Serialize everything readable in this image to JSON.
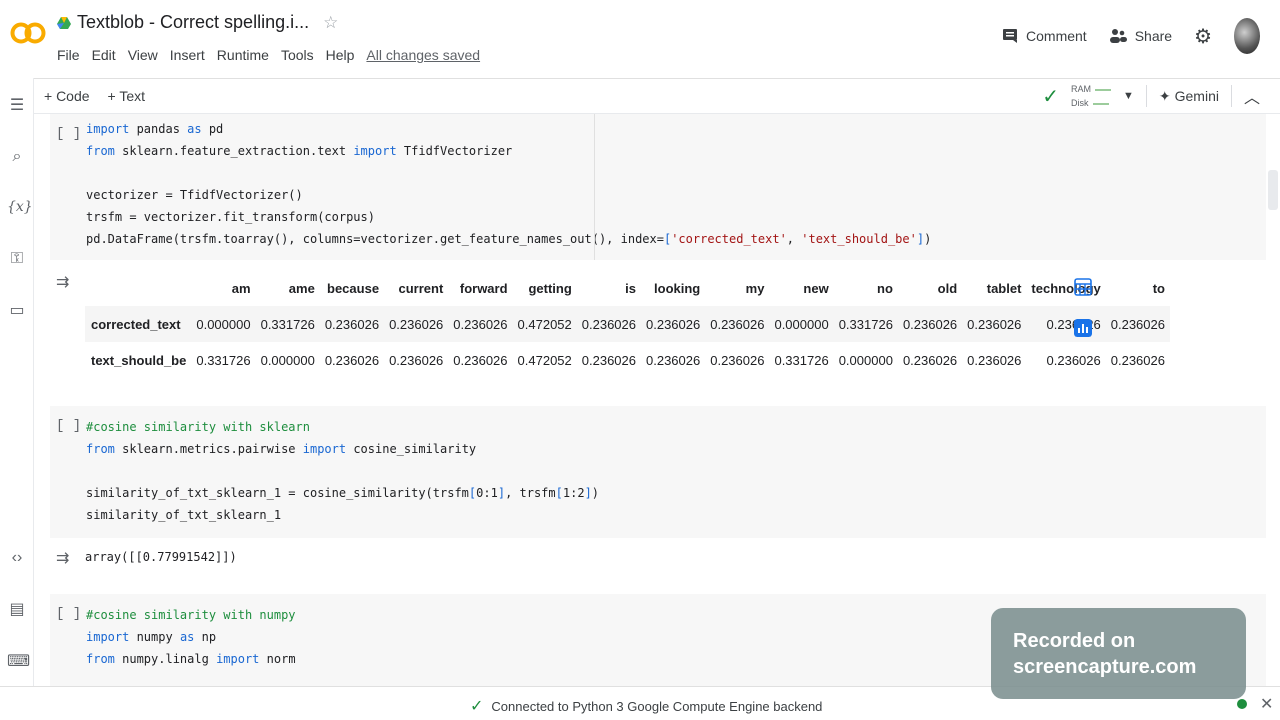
{
  "header": {
    "logo_text": "CO",
    "title": "Textblob - Correct spelling.i...",
    "menu": [
      "File",
      "Edit",
      "View",
      "Insert",
      "Runtime",
      "Tools",
      "Help"
    ],
    "saved_status": "All changes saved",
    "comment_label": "Comment",
    "share_label": "Share"
  },
  "toolbar": {
    "add_code": "+ Code",
    "add_text": "+ Text",
    "ram_label": "RAM",
    "disk_label": "Disk",
    "gemini_label": "Gemini"
  },
  "cells": {
    "cell1": {
      "run_indicator": "[ ]"
    },
    "cell2": {
      "run_indicator": "[ ]",
      "output": "array([[0.77991542]])"
    },
    "cell3": {
      "run_indicator": "[ ]"
    }
  },
  "dataframe": {
    "columns": [
      "am",
      "ame",
      "because",
      "current",
      "forward",
      "getting",
      "is",
      "looking",
      "my",
      "new",
      "no",
      "old",
      "tablet",
      "technology",
      "to"
    ],
    "rows": [
      {
        "index": "corrected_text",
        "values": [
          "0.000000",
          "0.331726",
          "0.236026",
          "0.236026",
          "0.236026",
          "0.472052",
          "0.236026",
          "0.236026",
          "0.236026",
          "0.000000",
          "0.331726",
          "0.236026",
          "0.236026",
          "0.236026",
          "0.236026"
        ]
      },
      {
        "index": "text_should_be",
        "values": [
          "0.331726",
          "0.000000",
          "0.236026",
          "0.236026",
          "0.236026",
          "0.472052",
          "0.236026",
          "0.236026",
          "0.236026",
          "0.331726",
          "0.000000",
          "0.236026",
          "0.236026",
          "0.236026",
          "0.236026"
        ]
      }
    ]
  },
  "status_bar": {
    "text": "Connected to Python 3 Google Compute Engine backend"
  },
  "watermark": {
    "line1": "Recorded on",
    "line2": "screencapture.com"
  },
  "colors": {
    "accent_orange": "#f9ab00",
    "keyword_blue": "#1967d2",
    "string_red": "#a31515",
    "ok_green": "#1e8e3e"
  }
}
